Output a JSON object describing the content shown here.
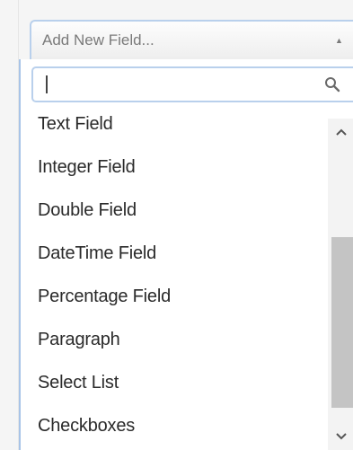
{
  "combo": {
    "placeholder": "Add New Field...",
    "caret_icon": "triangle-up-icon"
  },
  "search": {
    "value": "",
    "icon": "search-icon"
  },
  "field_types": [
    {
      "label": "Text Field"
    },
    {
      "label": "Integer Field"
    },
    {
      "label": "Double Field"
    },
    {
      "label": "DateTime Field"
    },
    {
      "label": "Percentage Field"
    },
    {
      "label": "Paragraph"
    },
    {
      "label": "Select List"
    },
    {
      "label": "Checkboxes"
    }
  ],
  "scrollbar": {
    "up_icon": "chevron-up-icon",
    "down_icon": "chevron-down-icon",
    "thumb_color": "#c4c4c4"
  },
  "colors": {
    "focus_border": "#b9d0ec",
    "item_text": "#2a2a2a",
    "placeholder_text": "#7a7a7a"
  }
}
